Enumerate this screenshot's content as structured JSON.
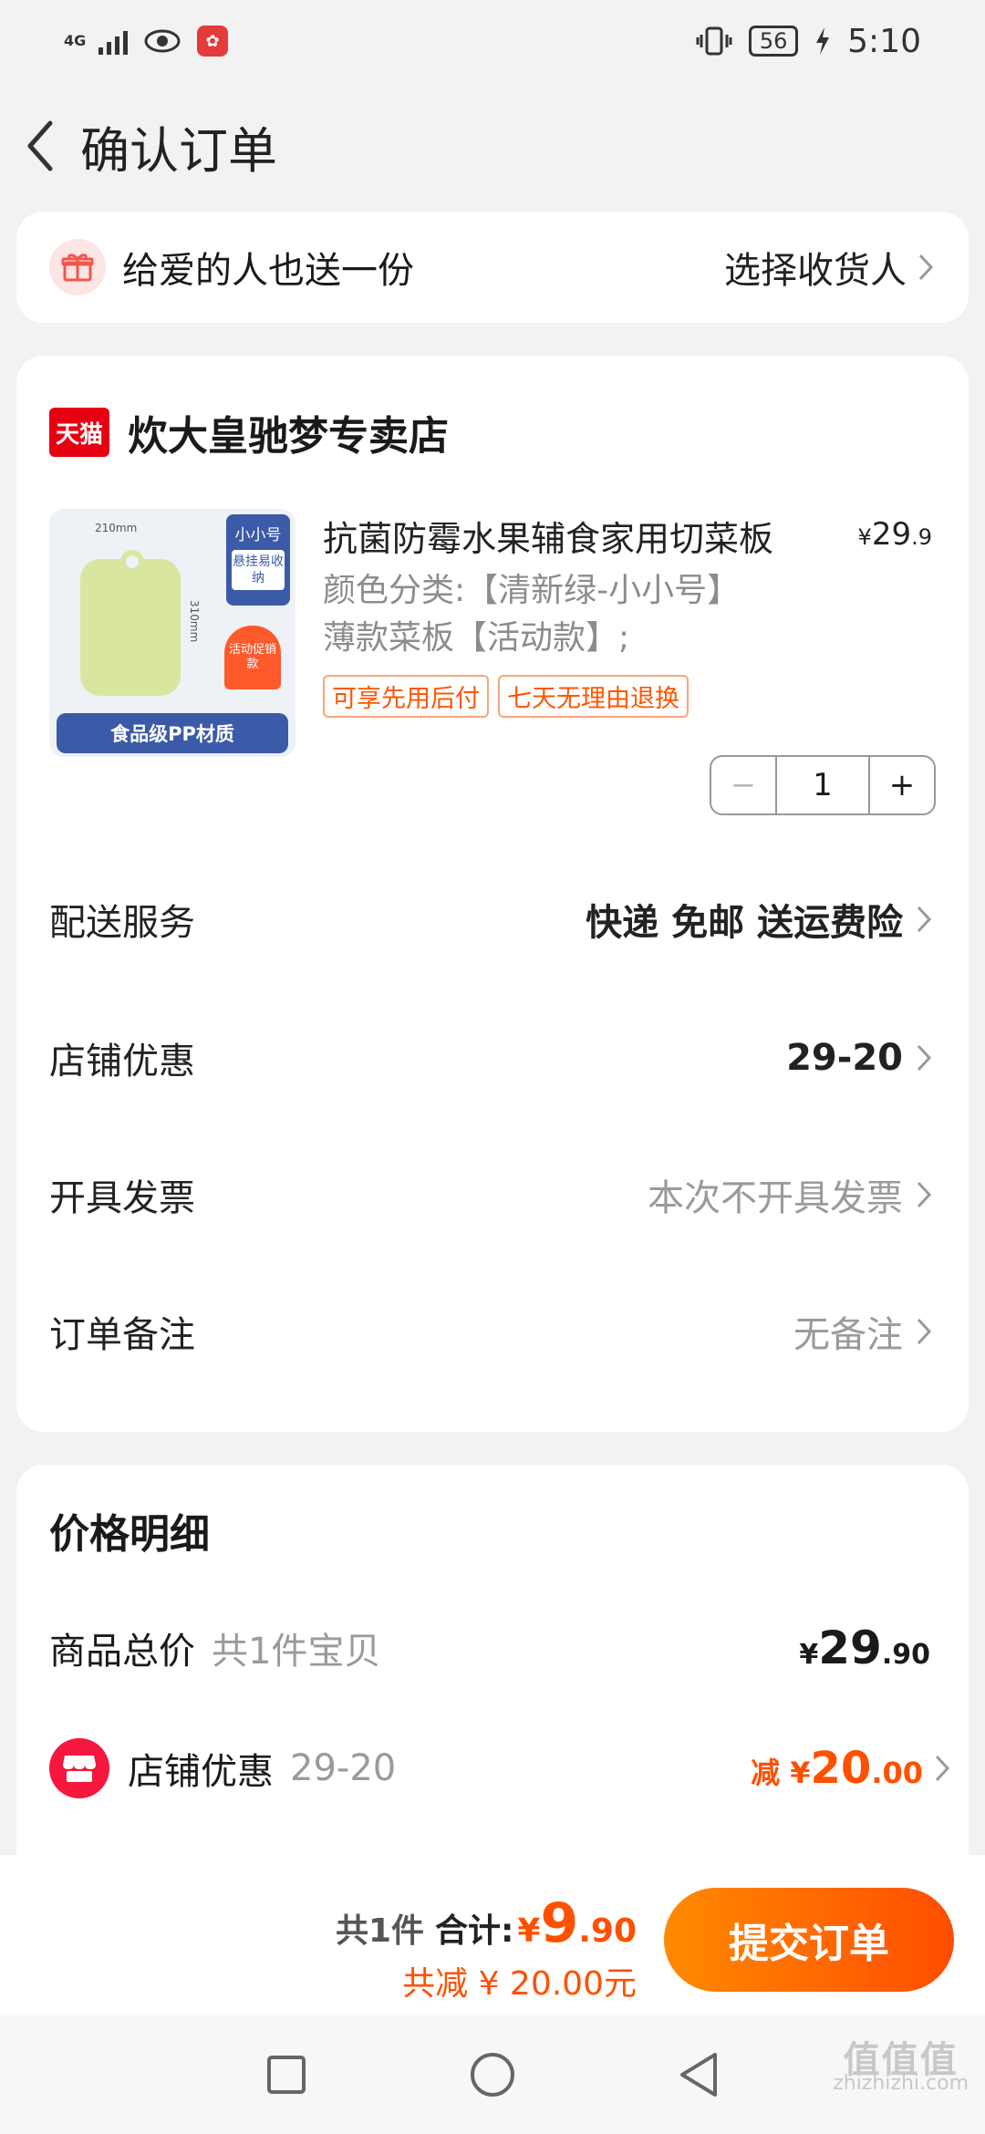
{
  "status_bar": {
    "network": "4G",
    "battery": "56",
    "time": "5:10",
    "app_badge": "✿"
  },
  "header": {
    "title": "确认订单"
  },
  "gift": {
    "text": "给爱的人也送一份",
    "action": "选择收货人"
  },
  "shop": {
    "logo_text": "天猫",
    "name": "炊大皇驰梦专卖店"
  },
  "product": {
    "title": "抗菌防霉水果辅食家用切菜板",
    "price_symbol": "¥",
    "price_int": "29",
    "price_dec": ".9",
    "spec_line1": "颜色分类:【清新绿-小小号】",
    "spec_line2": "薄款菜板【活动款】;",
    "tags": [
      "可享先用后付",
      "七天无理由退换"
    ],
    "image": {
      "size_label": "小小号",
      "hang_label": "悬挂易收纳",
      "promo_label": "活动促销款",
      "band_label": "食品级PP材质",
      "width_mark": "210mm",
      "height_mark": "310mm"
    },
    "quantity": "1",
    "minus": "−",
    "plus": "+"
  },
  "rows": {
    "delivery": {
      "label": "配送服务",
      "value": "快递 免邮 送运费险"
    },
    "shop_discount": {
      "label": "店铺优惠",
      "value": "29-20"
    },
    "invoice": {
      "label": "开具发票",
      "value": "本次不开具发票"
    },
    "note": {
      "label": "订单备注",
      "value": "无备注"
    }
  },
  "price_detail": {
    "title": "价格明细",
    "total_label": "商品总价",
    "total_count": "共1件宝贝",
    "total_symbol": "¥",
    "total_int": "29",
    "total_dec": ".90",
    "discount_label": "店铺优惠",
    "discount_rule": "29-20",
    "discount_prefix": "减",
    "discount_symbol": "¥",
    "discount_int": "20",
    "discount_dec": ".00"
  },
  "bottom_bar": {
    "count": "共1件",
    "sum_label": "合计:",
    "sum_symbol": "¥",
    "sum_int": "9",
    "sum_dec": ".90",
    "saved": "共减 ¥ 20.00元",
    "submit": "提交订单"
  },
  "watermark": {
    "brand": "值值值",
    "site": "zhizhizhi.com"
  },
  "colors": {
    "accent": "#ff5000",
    "tmall": "#e60012",
    "shop_badge": "#f5173d"
  }
}
